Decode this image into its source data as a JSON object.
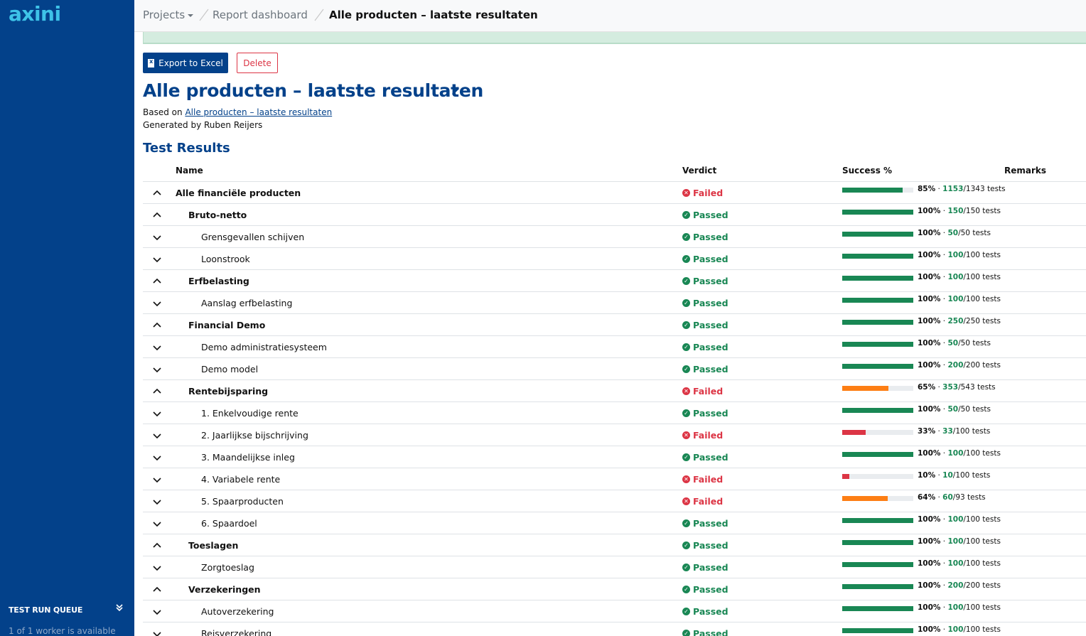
{
  "app": {
    "logo": "axini"
  },
  "sidebar": {
    "queue_title": "TEST RUN QUEUE",
    "queue_status": "1 of 1 worker is available"
  },
  "breadcrumb": {
    "projects": "Projects",
    "dashboard": "Report dashboard",
    "current": "Alle producten – laatste resultaten"
  },
  "actions": {
    "export_label": "Export to Excel",
    "delete_label": "Delete"
  },
  "page": {
    "title": "Alle producten – laatste resultaten",
    "based_on_prefix": "Based on",
    "based_on_link": "Alle producten – laatste resultaten",
    "generated_by": "Generated by Ruben Reijers"
  },
  "results": {
    "section_title": "Test Results",
    "columns": {
      "name": "Name",
      "verdict": "Verdict",
      "success": "Success %",
      "remarks": "Remarks"
    },
    "rows": [
      {
        "level": 0,
        "expanded": true,
        "name": "Alle financiële producten",
        "verdict": "Failed",
        "pct": "85%",
        "passed": "1153",
        "total": "/1343 tests",
        "fraction": 0.85
      },
      {
        "level": 1,
        "expanded": true,
        "name": "Bruto-netto",
        "verdict": "Passed",
        "pct": "100%",
        "passed": "150",
        "total": "/150 tests",
        "fraction": 1.0
      },
      {
        "level": 2,
        "expanded": false,
        "name": "Grensgevallen schijven",
        "verdict": "Passed",
        "pct": "100%",
        "passed": "50",
        "total": "/50 tests",
        "fraction": 1.0
      },
      {
        "level": 2,
        "expanded": false,
        "name": "Loonstrook",
        "verdict": "Passed",
        "pct": "100%",
        "passed": "100",
        "total": "/100 tests",
        "fraction": 1.0
      },
      {
        "level": 1,
        "expanded": true,
        "name": "Erfbelasting",
        "verdict": "Passed",
        "pct": "100%",
        "passed": "100",
        "total": "/100 tests",
        "fraction": 1.0
      },
      {
        "level": 2,
        "expanded": false,
        "name": "Aanslag erfbelasting",
        "verdict": "Passed",
        "pct": "100%",
        "passed": "100",
        "total": "/100 tests",
        "fraction": 1.0
      },
      {
        "level": 1,
        "expanded": true,
        "name": "Financial Demo",
        "verdict": "Passed",
        "pct": "100%",
        "passed": "250",
        "total": "/250 tests",
        "fraction": 1.0
      },
      {
        "level": 2,
        "expanded": false,
        "name": "Demo administratiesysteem",
        "verdict": "Passed",
        "pct": "100%",
        "passed": "50",
        "total": "/50 tests",
        "fraction": 1.0
      },
      {
        "level": 2,
        "expanded": false,
        "name": "Demo model",
        "verdict": "Passed",
        "pct": "100%",
        "passed": "200",
        "total": "/200 tests",
        "fraction": 1.0
      },
      {
        "level": 1,
        "expanded": true,
        "name": "Rentebijsparing",
        "verdict": "Failed",
        "pct": "65%",
        "passed": "353",
        "total": "/543 tests",
        "fraction": 0.65
      },
      {
        "level": 2,
        "expanded": false,
        "name": "1. Enkelvoudige rente",
        "verdict": "Passed",
        "pct": "100%",
        "passed": "50",
        "total": "/50 tests",
        "fraction": 1.0
      },
      {
        "level": 2,
        "expanded": false,
        "name": "2. Jaarlijkse bijschrijving",
        "verdict": "Failed",
        "pct": "33%",
        "passed": "33",
        "total": "/100 tests",
        "fraction": 0.33
      },
      {
        "level": 2,
        "expanded": false,
        "name": "3. Maandelijkse inleg",
        "verdict": "Passed",
        "pct": "100%",
        "passed": "100",
        "total": "/100 tests",
        "fraction": 1.0
      },
      {
        "level": 2,
        "expanded": false,
        "name": "4. Variabele rente",
        "verdict": "Failed",
        "pct": "10%",
        "passed": "10",
        "total": "/100 tests",
        "fraction": 0.1
      },
      {
        "level": 2,
        "expanded": false,
        "name": "5. Spaarproducten",
        "verdict": "Failed",
        "pct": "64%",
        "passed": "60",
        "total": "/93 tests",
        "fraction": 0.64
      },
      {
        "level": 2,
        "expanded": false,
        "name": "6. Spaardoel",
        "verdict": "Passed",
        "pct": "100%",
        "passed": "100",
        "total": "/100 tests",
        "fraction": 1.0
      },
      {
        "level": 1,
        "expanded": true,
        "name": "Toeslagen",
        "verdict": "Passed",
        "pct": "100%",
        "passed": "100",
        "total": "/100 tests",
        "fraction": 1.0
      },
      {
        "level": 2,
        "expanded": false,
        "name": "Zorgtoeslag",
        "verdict": "Passed",
        "pct": "100%",
        "passed": "100",
        "total": "/100 tests",
        "fraction": 1.0
      },
      {
        "level": 1,
        "expanded": true,
        "name": "Verzekeringen",
        "verdict": "Passed",
        "pct": "100%",
        "passed": "200",
        "total": "/200 tests",
        "fraction": 1.0
      },
      {
        "level": 2,
        "expanded": false,
        "name": "Autoverzekering",
        "verdict": "Passed",
        "pct": "100%",
        "passed": "100",
        "total": "/100 tests",
        "fraction": 1.0
      },
      {
        "level": 2,
        "expanded": false,
        "name": "Reisverzekering",
        "verdict": "Passed",
        "pct": "100%",
        "passed": "100",
        "total": "/100 tests",
        "fraction": 1.0
      }
    ]
  },
  "colors": {
    "brand": "#03418a",
    "logo": "#3ec3e8",
    "pass": "#198754",
    "fail": "#dc3545",
    "bar_good": "#198754",
    "bar_warn": "#fd7e14",
    "bar_bad": "#dc3545"
  }
}
